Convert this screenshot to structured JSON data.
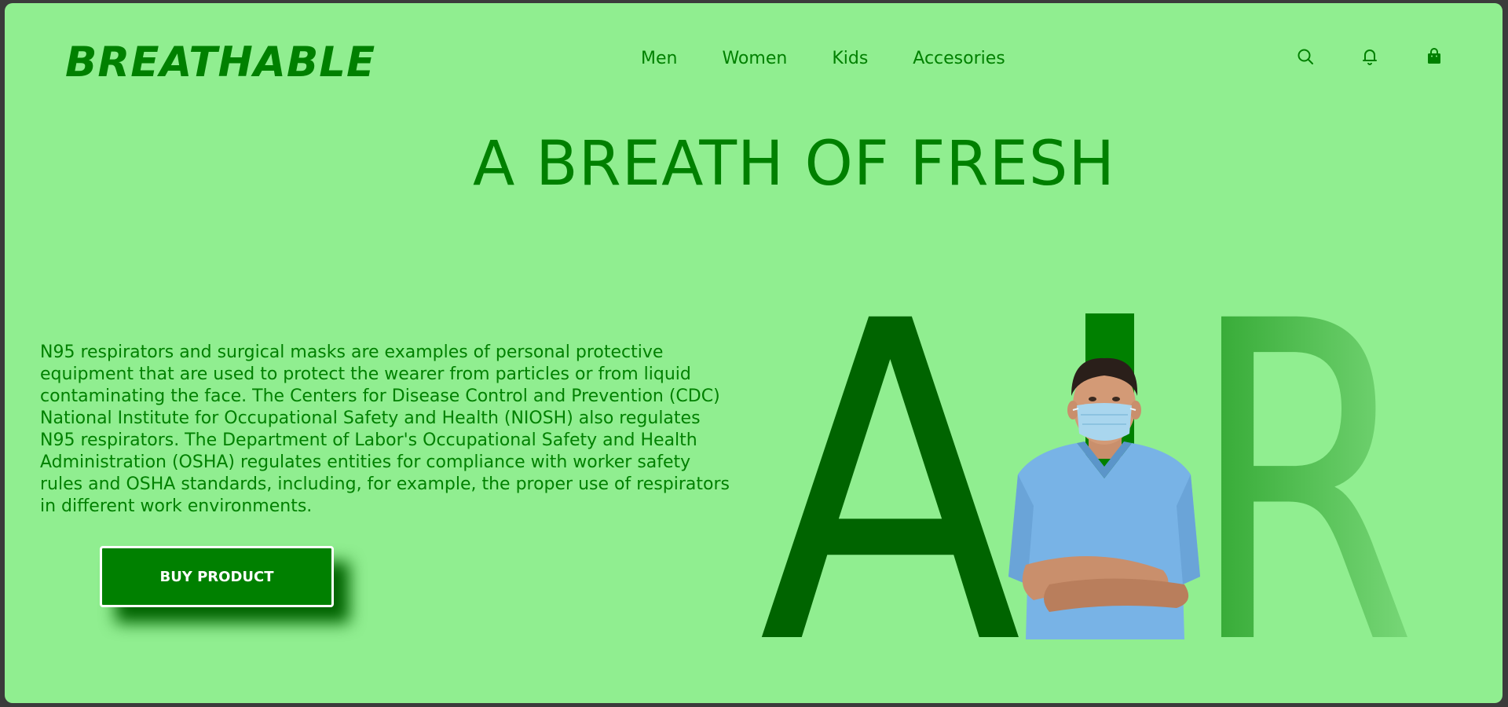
{
  "header": {
    "brand": "BREATHABLE",
    "nav": [
      "Men",
      "Women",
      "Kids",
      "Accesories"
    ],
    "icons": [
      "search-icon",
      "bell-icon",
      "shopping-bag-icon"
    ]
  },
  "hero": {
    "headline": "A BREATH OF FRESH",
    "description": "N95 respirators and surgical masks are examples of personal protective equipment that are used to protect the wearer from particles or from liquid contaminating the face. The Centers for Disease Control and Prevention (CDC) National Institute for Occupational Safety and Health (NIOSH) also regulates N95 respirators. The Department of Labor's Occupational Safety and Health Administration (OSHA) regulates entities for compliance with worker safety rules and OSHA standards, including, for example, the proper use of respirators in different work environments.",
    "button": "BUY PRODUCT",
    "big_word": {
      "letter_a": "A",
      "letter_i": "I",
      "letter_r": "R"
    }
  },
  "colors": {
    "background": "#90ee90",
    "accent": "#008000",
    "accent_dark": "#006400",
    "frame": "#3b3b3b"
  }
}
